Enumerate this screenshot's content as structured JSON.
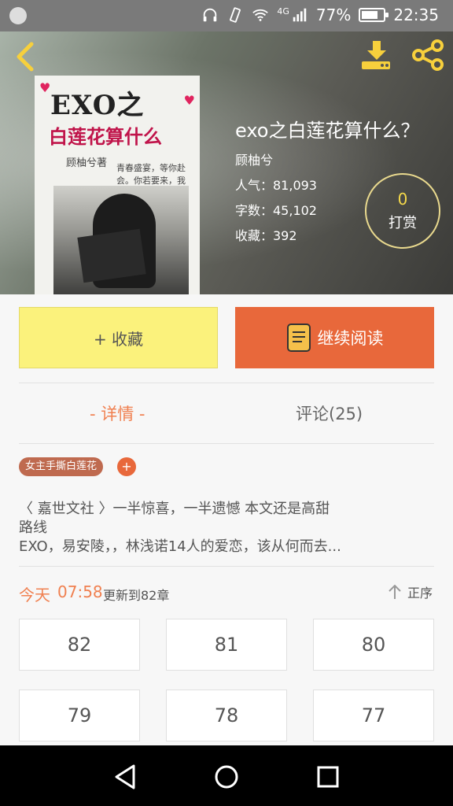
{
  "status_bar": {
    "network": "4G",
    "battery": "77%",
    "battery_level": 0.77,
    "time": "22:35"
  },
  "book": {
    "cover_title": "EXO之",
    "cover_subtitle": "白莲花算什么",
    "cover_author": "顾柚兮著",
    "cover_quote": "青春盛宴，等你赴会。你若要来，我便等候。",
    "title": "exo之白莲花算什么？",
    "author": "顾柚兮",
    "popularity": "人气：81,093",
    "word_count": "字数：45,102",
    "favorites": "收藏：392"
  },
  "tip": {
    "count": "0",
    "label": "打赏"
  },
  "actions": {
    "collect": "+ 收藏",
    "continue_reading": "继续阅读"
  },
  "tabs": {
    "detail": "- 详情 -",
    "comments": "评论(25)"
  },
  "tags": [
    "女主手撕白莲花"
  ],
  "tag_add": "+",
  "description": {
    "line1": "〈 嘉世文社 〉一半惊喜，一半遗憾            本文还是高甜",
    "line2": "路线",
    "line3": "EXO，易安陵，，林浅诺14人的爱恋，该从何而去..."
  },
  "update": {
    "today": "今天",
    "time": "07:58",
    "text": "更新到82章",
    "sort": "正序"
  },
  "chapters": [
    "82",
    "81",
    "80",
    "79",
    "78",
    "77"
  ]
}
